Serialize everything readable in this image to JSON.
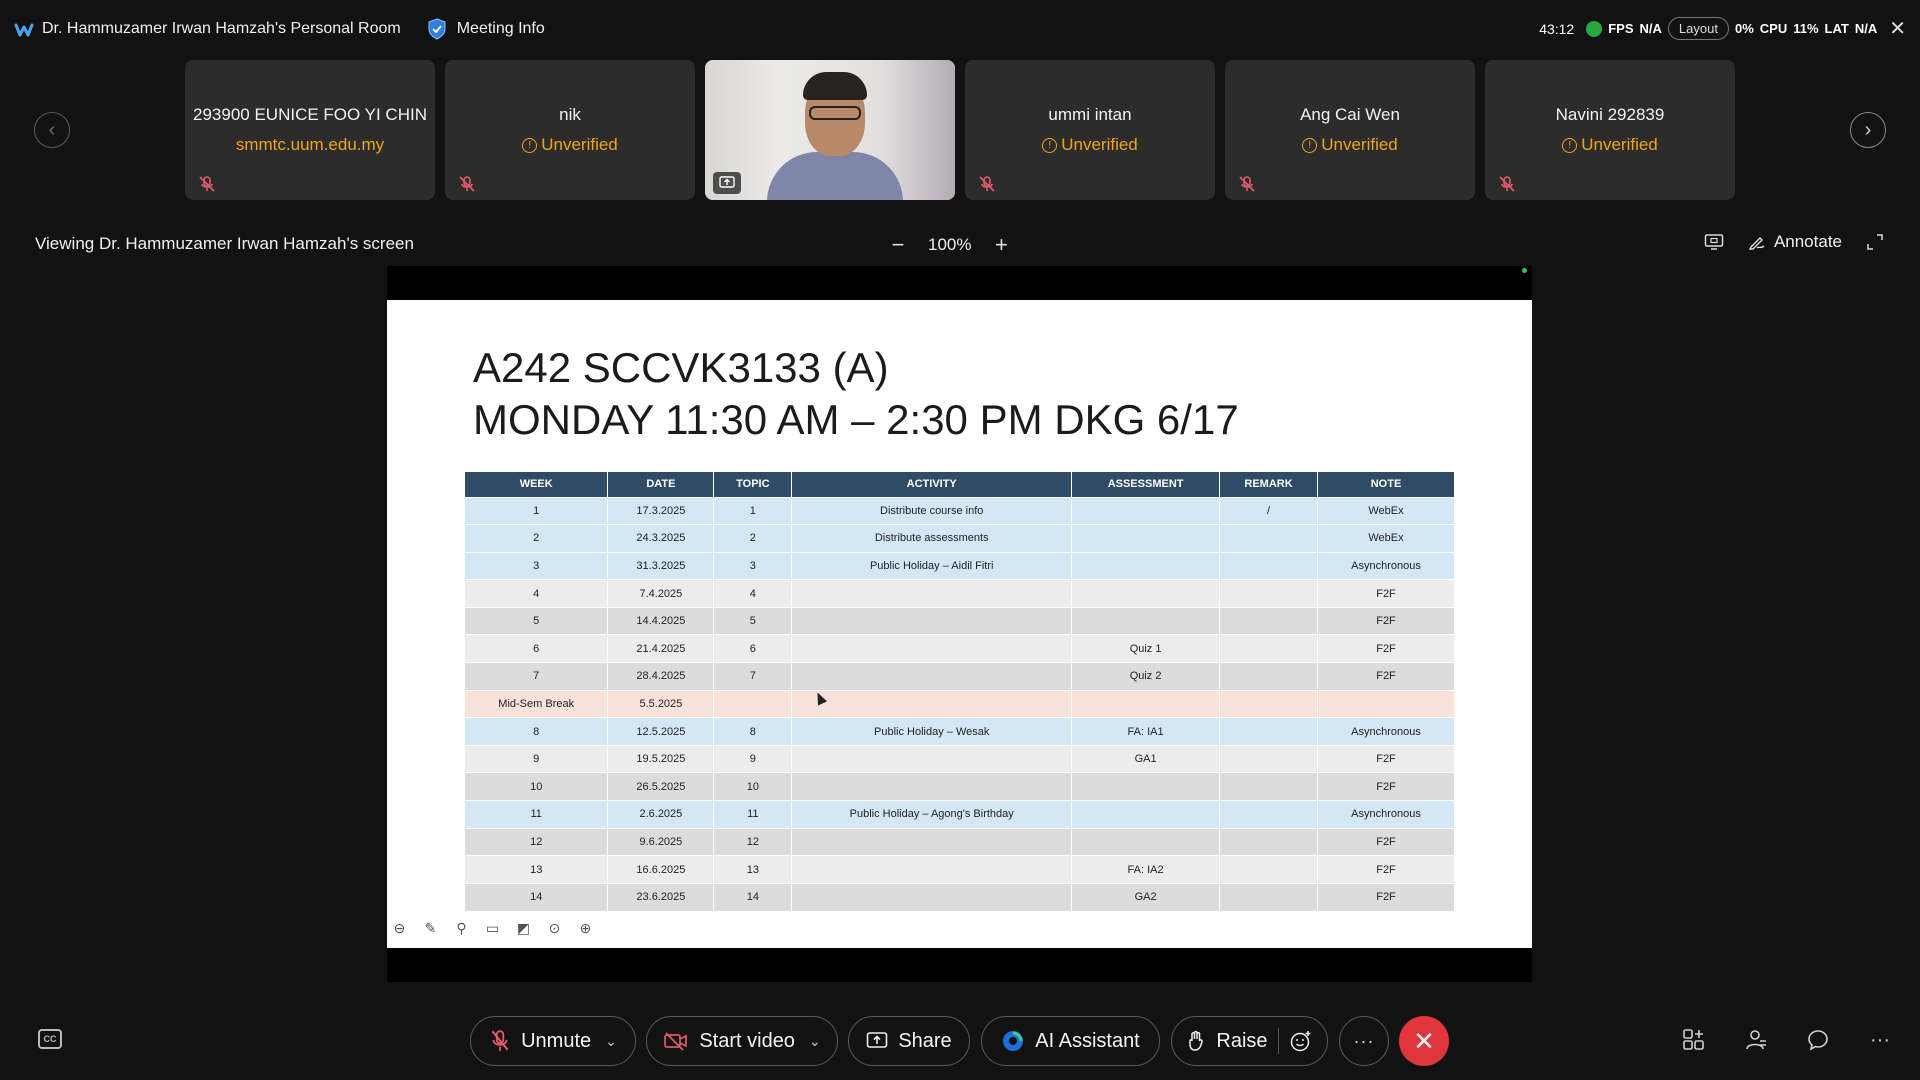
{
  "topbar": {
    "room_title": "Dr. Hammuzamer Irwan Hamzah's Personal Room",
    "meeting_info": "Meeting Info",
    "timer": "43:12",
    "stats_fps_label": "FPS",
    "stats_fps": "N/A",
    "stats_gpu": "0%",
    "stats_cpu_label": "CPU",
    "stats_cpu": "11%",
    "stats_lat_label": "LAT",
    "stats_lat": "N/A",
    "layout_label": "Layout"
  },
  "participants": [
    {
      "name": "293900 EUNICE FOO YI CHIN",
      "sub": "smmtc.uum.edu.my"
    },
    {
      "name": "nik",
      "sub": "Unverified"
    },
    {
      "name": "",
      "sub": ""
    },
    {
      "name": "ummi intan",
      "sub": "Unverified"
    },
    {
      "name": "Ang Cai Wen",
      "sub": "Unverified"
    },
    {
      "name": "Navini 292839",
      "sub": "Unverified"
    }
  ],
  "viewbar": {
    "viewing_label": "Viewing Dr. Hammuzamer Irwan Hamzah's screen",
    "zoom_level": "100%",
    "annotate_label": "Annotate"
  },
  "slide": {
    "title_line1": "A242 SCCVK3133 (A)",
    "title_line2": "MONDAY 11:30 AM – 2:30 PM DKG 6/17",
    "headers": [
      "WEEK",
      "DATE",
      "TOPIC",
      "ACTIVITY",
      "ASSESSMENT",
      "REMARK",
      "NOTE"
    ],
    "rows": [
      [
        "1",
        "17.3.2025",
        "1",
        "Distribute course info",
        "",
        "/",
        "WebEx"
      ],
      [
        "2",
        "24.3.2025",
        "2",
        "Distribute assessments",
        "",
        "",
        "WebEx"
      ],
      [
        "3",
        "31.3.2025",
        "3",
        "Public Holiday – Aidil Fitri",
        "",
        "",
        "Asynchronous"
      ],
      [
        "4",
        "7.4.2025",
        "4",
        "",
        "",
        "",
        "F2F"
      ],
      [
        "5",
        "14.4.2025",
        "5",
        "",
        "",
        "",
        "F2F"
      ],
      [
        "6",
        "21.4.2025",
        "6",
        "",
        "Quiz 1",
        "",
        "F2F"
      ],
      [
        "7",
        "28.4.2025",
        "7",
        "",
        "Quiz 2",
        "",
        "F2F"
      ],
      [
        "Mid-Sem Break",
        "5.5.2025",
        "",
        "",
        "",
        "",
        ""
      ],
      [
        "8",
        "12.5.2025",
        "8",
        "Public Holiday – Wesak",
        "FA: IA1",
        "",
        "Asynchronous"
      ],
      [
        "9",
        "19.5.2025",
        "9",
        "",
        "GA1",
        "",
        "F2F"
      ],
      [
        "10",
        "26.5.2025",
        "10",
        "",
        "",
        "",
        "F2F"
      ],
      [
        "11",
        "2.6.2025",
        "11",
        "Public Holiday – Agong's Birthday",
        "",
        "",
        "Asynchronous"
      ],
      [
        "12",
        "9.6.2025",
        "12",
        "",
        "",
        "",
        "F2F"
      ],
      [
        "13",
        "16.6.2025",
        "13",
        "",
        "FA: IA2",
        "",
        "F2F"
      ],
      [
        "14",
        "23.6.2025",
        "14",
        "",
        "GA2",
        "",
        "F2F"
      ]
    ]
  },
  "bottombar": {
    "unmute_label": "Unmute",
    "start_video_label": "Start video",
    "share_label": "Share",
    "ai_assistant_label": "AI Assistant",
    "raise_label": "Raise",
    "cc_label": "CC"
  },
  "colors": {
    "accent_unverified": "#f0a51c",
    "end_call": "#e0363b",
    "table_header": "#2f4b66"
  }
}
